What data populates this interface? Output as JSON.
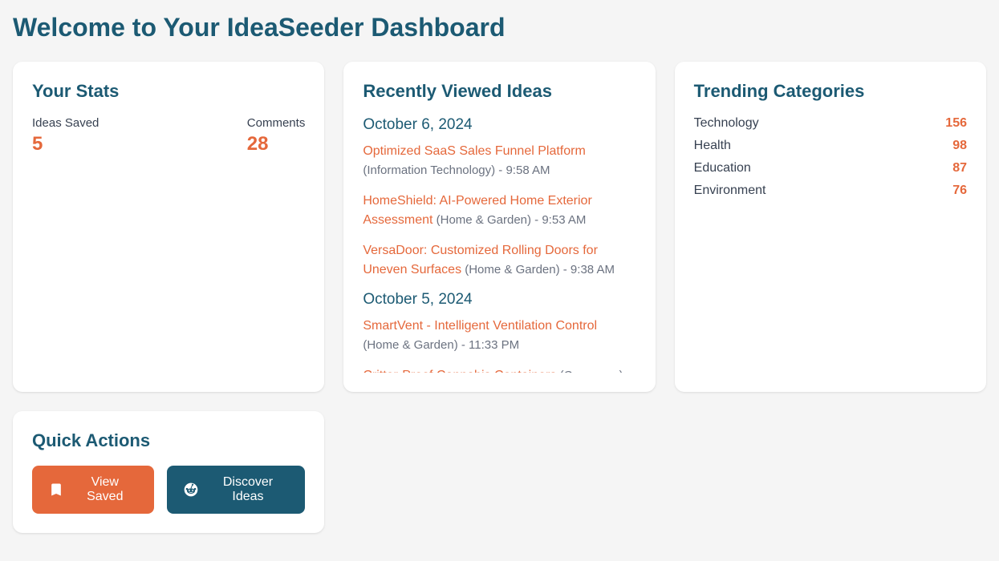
{
  "pageTitle": "Welcome to Your IdeaSeeder Dashboard",
  "stats": {
    "title": "Your Stats",
    "items": [
      {
        "label": "Ideas Saved",
        "value": "5"
      },
      {
        "label": "Comments",
        "value": "28"
      }
    ]
  },
  "recent": {
    "title": "Recently Viewed Ideas",
    "groups": [
      {
        "date": "October 6, 2024",
        "ideas": [
          {
            "title": "Optimized SaaS Sales Funnel Platform",
            "category": "Information Technology",
            "time": "9:58 AM"
          },
          {
            "title": "HomeShield: AI-Powered Home Exterior Assessment",
            "category": "Home & Garden",
            "time": "9:53 AM"
          },
          {
            "title": "VersaDoor: Customized Rolling Doors for Uneven Surfaces",
            "category": "Home & Garden",
            "time": "9:38 AM"
          }
        ]
      },
      {
        "date": "October 5, 2024",
        "ideas": [
          {
            "title": "SmartVent - Intelligent Ventilation Control",
            "category": "Home & Garden",
            "time": "11:33 PM"
          },
          {
            "title": "Critter-Proof Cannabis Containers",
            "category": "Consumer",
            "time": ""
          }
        ]
      }
    ]
  },
  "trending": {
    "title": "Trending Categories",
    "items": [
      {
        "name": "Technology",
        "count": "156"
      },
      {
        "name": "Health",
        "count": "98"
      },
      {
        "name": "Education",
        "count": "87"
      },
      {
        "name": "Environment",
        "count": "76"
      }
    ]
  },
  "quickActions": {
    "title": "Quick Actions",
    "buttons": {
      "viewSaved": "View Saved",
      "discover": "Discover Ideas"
    }
  }
}
